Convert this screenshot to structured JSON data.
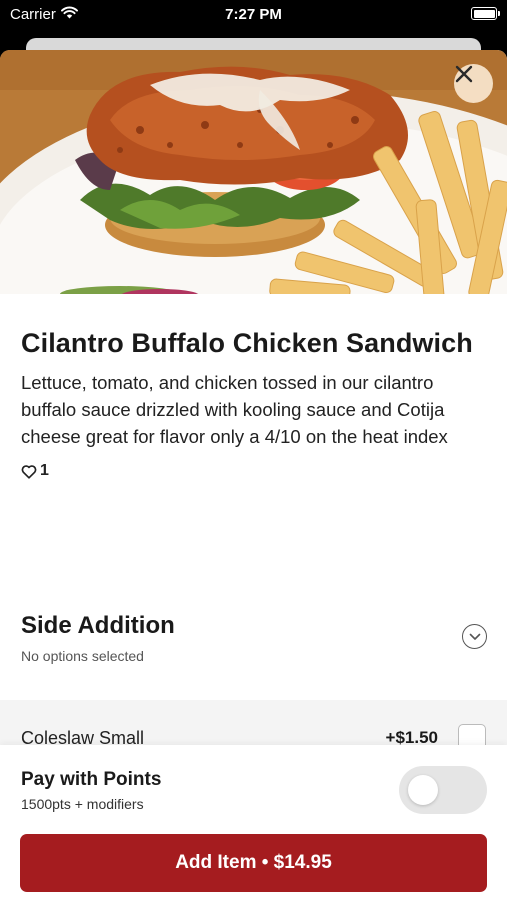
{
  "status_bar": {
    "carrier": "Carrier",
    "time": "7:27 PM",
    "wifi_icon": "wifi-icon",
    "battery_icon": "battery-icon"
  },
  "hero": {
    "image_subject": "fried chicken sandwich with fries",
    "close_icon": "close-icon"
  },
  "item": {
    "title": "Cilantro Buffalo Chicken Sandwich",
    "description": "Lettuce, tomato, and chicken tossed in our cilantro buffalo sauce drizzled with kooling sauce and Cotija cheese great for flavor only a 4/10 on the heat index",
    "likes_count": "1",
    "like_icon": "heart-icon"
  },
  "side_addition": {
    "title": "Side Addition",
    "subtitle": "No options selected",
    "expand_icon": "chevron-down-icon",
    "options": [
      {
        "name": "Coleslaw Small",
        "price": "+$1.50",
        "checked": false
      }
    ]
  },
  "points": {
    "title": "Pay with Points",
    "subtitle": "1500pts + modifiers",
    "enabled": false
  },
  "add_button": {
    "label": "Add Item • $14.95"
  },
  "colors": {
    "accent": "#a51c1f",
    "toggle_off": "#e5e5e5",
    "options_bg": "#f4f4f4"
  }
}
